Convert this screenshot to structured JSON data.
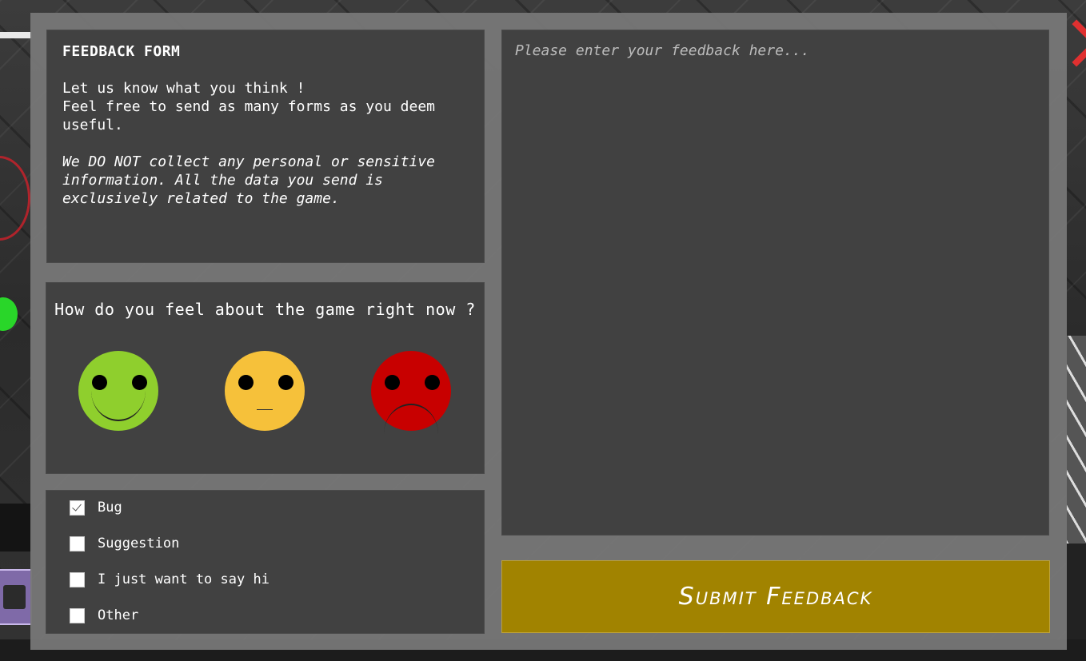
{
  "form": {
    "title": "FEEDBACK FORM",
    "intro_line1": "Let us know what you think !",
    "intro_line2": "Feel free to send as many forms as you deem useful.",
    "privacy_note": "We DO NOT collect any personal or sensitive information. All the data you send is exclusively related to the game."
  },
  "mood": {
    "question": "How do you feel about the game right now ?",
    "options": [
      {
        "name": "happy",
        "color": "#8fcf2d",
        "checked": true
      },
      {
        "name": "neutral",
        "color": "#f6c13a",
        "checked": false
      },
      {
        "name": "sad",
        "color": "#c80000",
        "checked": false
      }
    ]
  },
  "categories": [
    {
      "label": "Bug",
      "checked": true
    },
    {
      "label": "Suggestion",
      "checked": false
    },
    {
      "label": "I just want to say hi",
      "checked": false
    },
    {
      "label": "Other",
      "checked": false
    }
  ],
  "feedback": {
    "value": "",
    "placeholder": "Please enter your feedback here..."
  },
  "submit": {
    "label": "Submit Feedback"
  },
  "colors": {
    "panel": "#414141",
    "frame": "#767676",
    "submit": "#a18300"
  }
}
